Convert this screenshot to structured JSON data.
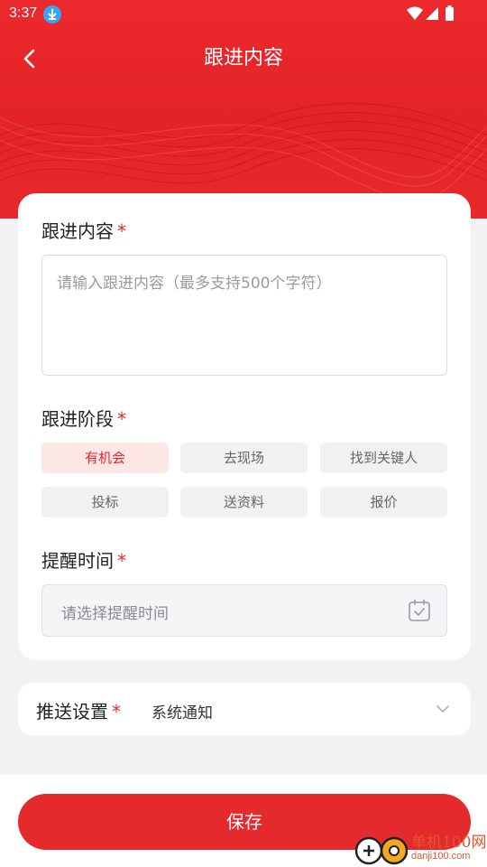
{
  "status_bar": {
    "time": "3:37"
  },
  "header": {
    "title": "跟进内容"
  },
  "content_section": {
    "label": "跟进内容",
    "required_mark": "*",
    "placeholder": "请输入跟进内容（最多支持500个字符）"
  },
  "stage_section": {
    "label": "跟进阶段",
    "required_mark": "*",
    "options": [
      "有机会",
      "去现场",
      "找到关键人",
      "投标",
      "送资料",
      "报价"
    ],
    "selected": "有机会"
  },
  "reminder_section": {
    "label": "提醒时间",
    "required_mark": "*",
    "placeholder": "请选择提醒时间"
  },
  "push_section": {
    "label": "推送设置",
    "required_mark": "*",
    "value": "系统通知"
  },
  "save_button": {
    "label": "保存"
  },
  "watermark": {
    "name": "单机100网",
    "url": "danji100.com"
  },
  "colors": {
    "primary": "#e42a2d",
    "chip_active_bg": "#fde6e6",
    "chip_bg": "#f1f1f3"
  }
}
